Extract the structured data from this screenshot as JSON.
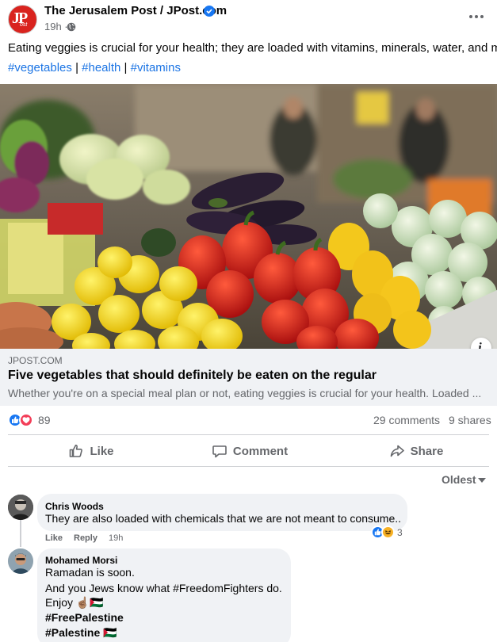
{
  "header": {
    "page_name": "The Jerusalem Post / JPost.com",
    "avatar_logo_text": "JPost",
    "time": "19h ·",
    "verified_icon": "verified-badge-icon",
    "globe_icon": "globe-icon",
    "more_icon": "more-options-icon"
  },
  "post": {
    "text": "Eating veggies is crucial for your health; they are loaded with vitamins, minerals, water, and more.",
    "hashtags": [
      "#vegetables",
      "#health",
      "#vitamins"
    ],
    "separator": "|"
  },
  "link_preview": {
    "domain": "JPOST.COM",
    "title": "Five vegetables that should definitely be eaten on the regular",
    "description": "Whether you're on a special meal plan or not, eating veggies is crucial for your health. Loaded ...",
    "info_icon": "i"
  },
  "stats": {
    "reactions_count": "89",
    "reaction_types": [
      "like",
      "love"
    ],
    "comments": "29 comments",
    "shares": "9 shares"
  },
  "actions": {
    "like": "Like",
    "comment": "Comment",
    "share": "Share"
  },
  "comments_sort": "Oldest",
  "comments": [
    {
      "author": "Chris Woods",
      "text": "They are also loaded with chemicals that we are not meant to consume..",
      "like_label": "Like",
      "reply_label": "Reply",
      "time": "19h",
      "reaction_count": "3",
      "reaction_types": [
        "like",
        "haha"
      ]
    },
    {
      "author": "Mohamed Morsi",
      "lines": [
        "Ramadan is soon.",
        "And you Jews know what #FreedomFighters do.",
        "Enjoy ☝🏽🇵🇸",
        "#FreePalestine",
        "#Palestine 🇵🇸"
      ]
    }
  ],
  "colors": {
    "link_blue": "#1b74e4",
    "like_blue": "#1877f2",
    "love_red": "#f33e58",
    "secondary_text": "#65676b",
    "bubble_bg": "#f0f2f5"
  }
}
